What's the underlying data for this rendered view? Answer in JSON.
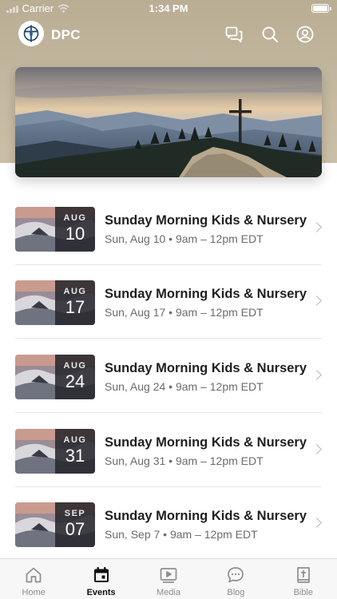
{
  "status_bar": {
    "carrier": "Carrier",
    "time": "1:34 PM"
  },
  "header": {
    "app_name": "DPC",
    "logo_icon": "cross-compass-icon",
    "icons": [
      "messages-icon",
      "search-icon",
      "profile-icon"
    ]
  },
  "hero": {
    "image": "mountain-cross-landscape"
  },
  "events": [
    {
      "month": "AUG",
      "day": "10",
      "title": "Sunday Morning Kids & Nursery",
      "meta": "Sun, Aug 10 • 9am – 12pm EDT"
    },
    {
      "month": "AUG",
      "day": "17",
      "title": "Sunday Morning Kids & Nursery",
      "meta": "Sun, Aug 17 • 9am – 12pm EDT"
    },
    {
      "month": "AUG",
      "day": "24",
      "title": "Sunday Morning Kids & Nursery",
      "meta": "Sun, Aug 24 • 9am – 12pm EDT"
    },
    {
      "month": "AUG",
      "day": "31",
      "title": "Sunday Morning Kids & Nursery",
      "meta": "Sun, Aug 31 • 9am – 12pm EDT"
    },
    {
      "month": "SEP",
      "day": "07",
      "title": "Sunday Morning Kids & Nursery",
      "meta": "Sun, Sep 7 • 9am – 12pm EDT"
    }
  ],
  "tabs": [
    {
      "label": "Home",
      "icon": "home-icon",
      "active": false
    },
    {
      "label": "Events",
      "icon": "calendar-icon",
      "active": true
    },
    {
      "label": "Media",
      "icon": "media-icon",
      "active": false
    },
    {
      "label": "Blog",
      "icon": "chat-bubble-icon",
      "active": false
    },
    {
      "label": "Bible",
      "icon": "bible-icon",
      "active": false
    }
  ],
  "colors": {
    "header_band": "#c2b69d",
    "active_tab": "#111111",
    "inactive_tab": "#8e8e8e"
  }
}
